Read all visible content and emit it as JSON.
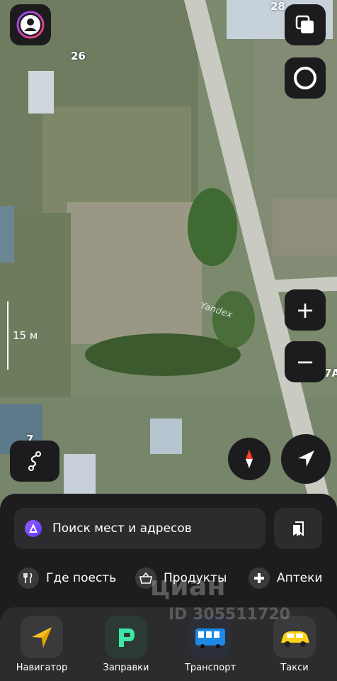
{
  "map": {
    "house_numbers": [
      "26",
      "28",
      "7",
      "7А"
    ],
    "watermark": "Yandex",
    "scale_label": "15 м",
    "colors": {
      "ground": "#7b8a6c",
      "road": "#c9cbc2",
      "button_bg": "#1c1c1e"
    }
  },
  "controls": {
    "profile_icon": "avatar-icon",
    "layers_icon": "layers-icon",
    "alice_icon": "alice-ring-icon",
    "zoom_in": "+",
    "zoom_out": "−",
    "route_icon": "route-icon",
    "compass_icon": "compass-icon",
    "locate_icon": "location-arrow-icon"
  },
  "search": {
    "placeholder": "Поиск мест и адресов",
    "bookmarks_icon": "bookmarks-icon"
  },
  "categories": [
    {
      "label": "Где поесть",
      "icon": "fork-knife-icon"
    },
    {
      "label": "Продукты",
      "icon": "basket-icon"
    },
    {
      "label": "Аптеки",
      "icon": "pharmacy-cross-icon"
    }
  ],
  "apps": [
    {
      "label": "Навигатор",
      "icon": "navigator-icon"
    },
    {
      "label": "Заправки",
      "icon": "fuel-icon"
    },
    {
      "label": "Транспорт",
      "icon": "bus-icon"
    },
    {
      "label": "Такси",
      "icon": "taxi-icon"
    }
  ],
  "overlay_watermark": {
    "brand": "циан",
    "id": "ID 305511720"
  }
}
